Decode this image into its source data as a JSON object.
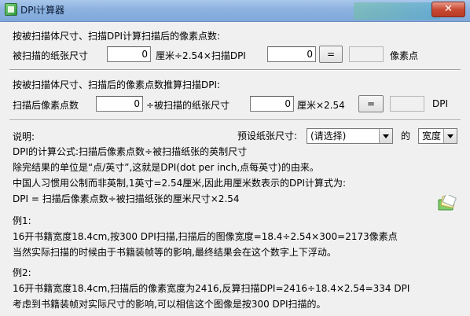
{
  "window": {
    "title": "DPI计算器",
    "close_glyph": "✕"
  },
  "section1": {
    "heading": "按被扫描体尺寸、扫描DPI计算扫描后的像素点数:",
    "paper_label": "被扫描的纸张尺寸",
    "paper_value": "0",
    "mid_label": "厘米÷2.54×扫描DPI",
    "dpi_value": "0",
    "equals_label": "=",
    "result_value": "",
    "unit_label": "像素点"
  },
  "section2": {
    "heading": "按被扫描体尺寸、扫描后的像素点数推算扫描DPI:",
    "pixels_label": "扫描后像素点数",
    "pixels_value": "0",
    "mid_label": "÷被扫描的纸张尺寸",
    "paper_value": "0",
    "mid2_label": "厘米×2.54",
    "equals_label": "=",
    "result_value": "",
    "unit_label": "DPI"
  },
  "notes": {
    "heading": "说明:",
    "preset_label": "预设纸张尺寸:",
    "preset_selected": "(请选择)",
    "of_label": "的",
    "dimension_selected": "宽度",
    "lines": [
      "DPI的计算公式:扫描后像素点数÷被扫描纸张的英制尺寸",
      "除完结果的单位是“点/英寸”,这就是DPI(dot per inch,点每英寸)的由来。",
      "中国人习惯用公制而非英制,1英寸=2.54厘米,因此用厘米数表示的DPI计算式为:",
      "DPI = 扫描后像素点数÷被扫描纸张的厘米尺寸×2.54",
      "例1:",
      "16开书籍宽度18.4cm,按300 DPI扫描,扫描后的图像宽度=18.4÷2.54×300=2173像素点",
      "当然实际扫描的时候由于书籍装帧等的影响,最终结果会在这个数字上下浮动。",
      "例2:",
      "16开书籍宽度18.4cm,扫描后的像素宽度为2416,反算扫描DPI=2416÷18.4×2.54=334 DPI",
      "考虑到书籍装帧对实际尺寸的影响,可以相信这个图像是按300 DPI扫描的。"
    ]
  }
}
